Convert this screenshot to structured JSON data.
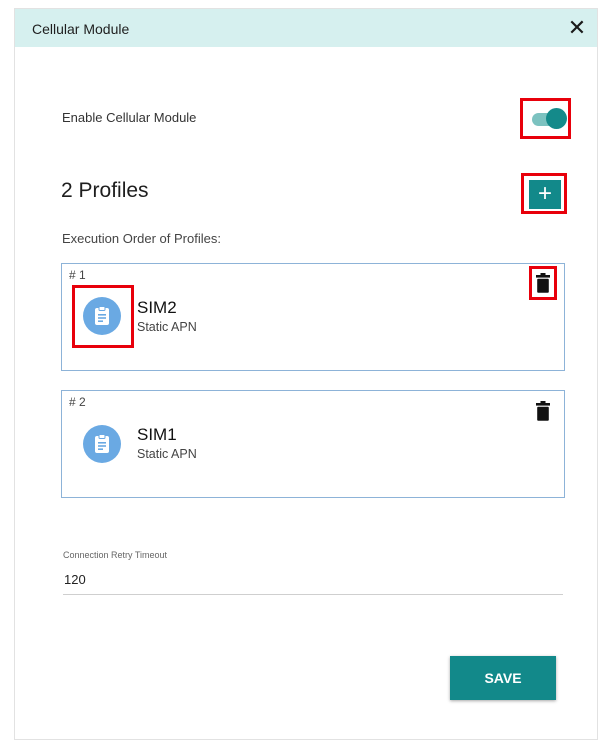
{
  "dialog": {
    "title": "Cellular Module",
    "close_icon": "close-icon"
  },
  "enable": {
    "label": "Enable Cellular Module",
    "enabled": true
  },
  "profiles": {
    "title": "2 Profiles",
    "add_label": "+",
    "execution_label": "Execution Order of Profiles:",
    "items": [
      {
        "order": "# 1",
        "name": "SIM2",
        "type": "Static APN",
        "icon": "clipboard-icon",
        "delete_icon": "trash-icon"
      },
      {
        "order": "# 2",
        "name": "SIM1",
        "type": "Static APN",
        "icon": "clipboard-icon",
        "delete_icon": "trash-icon"
      }
    ]
  },
  "retry": {
    "label": "Connection Retry Timeout",
    "value": "120"
  },
  "save_label": "SAVE",
  "colors": {
    "accent": "#12898a",
    "header_bg": "#d6f0ef",
    "highlight": "#e8000b",
    "avatar": "#6aa9e3"
  }
}
